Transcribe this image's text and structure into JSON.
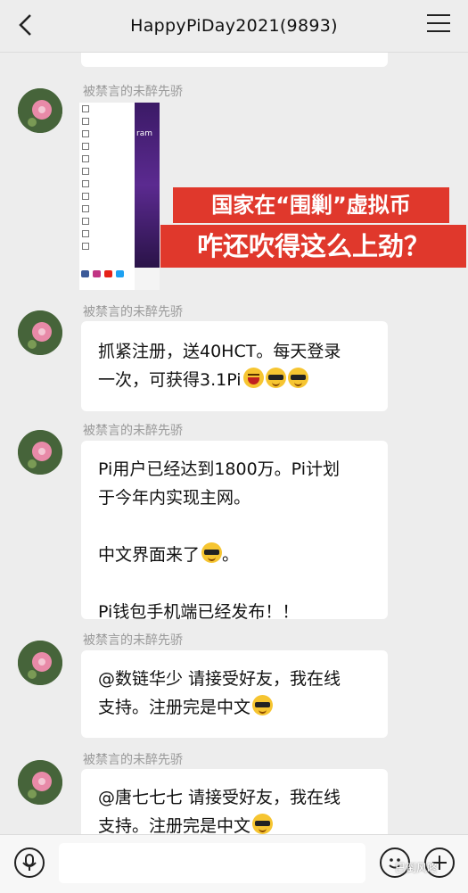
{
  "header": {
    "title": "HappyPiDay2021(9893)"
  },
  "image_message": {
    "sender": "被禁言的未醉先骄",
    "screenshot_text": "ram",
    "banner_line1": "国家在“围剿”虚拟币",
    "banner_line2": "咋还吹得这么上劲？"
  },
  "messages": [
    {
      "sender": "被禁言的未醉先骄",
      "lines": [
        "抓紧注册，送40HCT。每天登录",
        "一次，可获得3.1Pi"
      ]
    },
    {
      "sender": "被禁言的未醉先骄",
      "lines": [
        "Pi用户已经达到1800万。Pi计划",
        "于今年内实现主网。",
        "",
        "中文界面来了",
        "",
        "Pi钱包手机端已经发布！！"
      ],
      "after_emoji": "。"
    },
    {
      "sender": "被禁言的未醉先骄",
      "lines": [
        "@数链华少 请接受好友，我在线",
        "支持。注册完是中文"
      ]
    },
    {
      "sender": "被禁言的未醉先骄",
      "lines": [
        "@唐七七七 请接受好友，我在线",
        "支持。注册完是中文"
      ]
    }
  ],
  "input": {
    "placeholder": ""
  },
  "watermark": "巴倒风咚",
  "icons": {
    "back": "chevron-left-icon",
    "menu": "hamburger-menu-icon",
    "voice": "microphone-icon",
    "emoji": "smiley-icon",
    "plus": "plus-icon"
  },
  "colors": {
    "banner": "#e0382c",
    "background": "#ededed"
  }
}
